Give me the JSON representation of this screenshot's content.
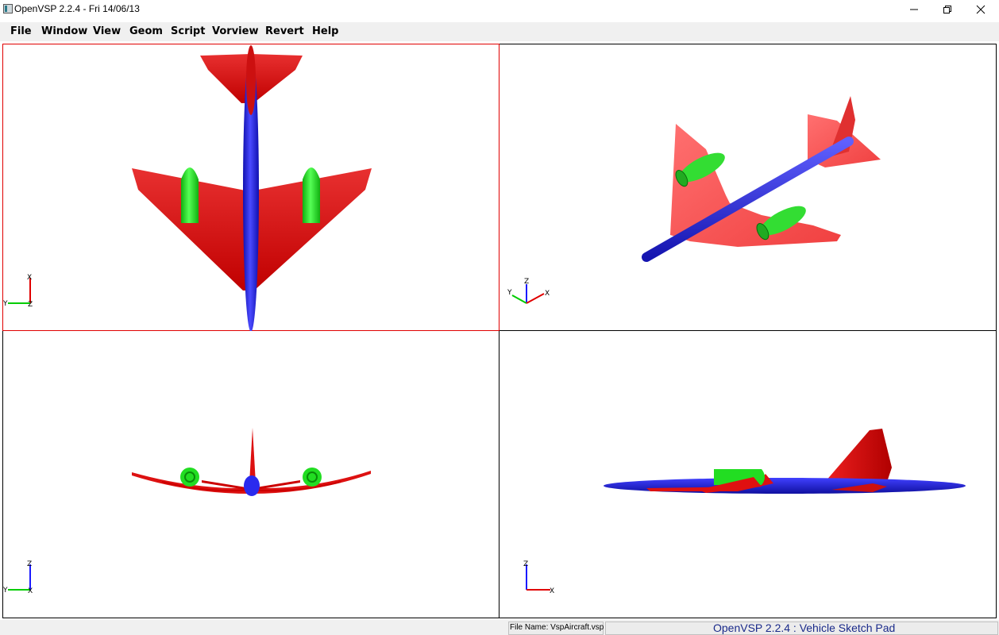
{
  "window": {
    "title": "OpenVSP 2.2.4 - Fri 14/06/13",
    "app_icon": "openvsp-app-icon",
    "controls": [
      "minimize-icon",
      "restore-icon",
      "close-icon"
    ]
  },
  "menu": {
    "items": [
      {
        "label": "File"
      },
      {
        "label": "Window"
      },
      {
        "label": "View"
      },
      {
        "label": "Geom"
      },
      {
        "label": "Script"
      },
      {
        "label": "Vorview"
      },
      {
        "label": "Revert"
      },
      {
        "label": "Help"
      }
    ]
  },
  "viewports": {
    "top": {
      "active": true,
      "axes": {
        "horizontal": "Y",
        "vertical": "X",
        "center": "Z"
      }
    },
    "iso": {
      "active": false,
      "axes": {
        "a": "Y",
        "b": "Z",
        "c": "X"
      }
    },
    "front": {
      "active": false,
      "axes": {
        "horizontal": "Y",
        "vertical": "Z"
      }
    },
    "side": {
      "active": false,
      "axes": {
        "horizontal": "X",
        "vertical": "Z"
      }
    }
  },
  "colors": {
    "fuselage": "#2222dd",
    "wing": "#dd1111",
    "nacelle": "#22dd22",
    "active_border": "#e00000"
  },
  "status": {
    "file_name": "File Name: VspAircraft.vsp",
    "app_name": "OpenVSP 2.2.4 : Vehicle Sketch Pad"
  }
}
